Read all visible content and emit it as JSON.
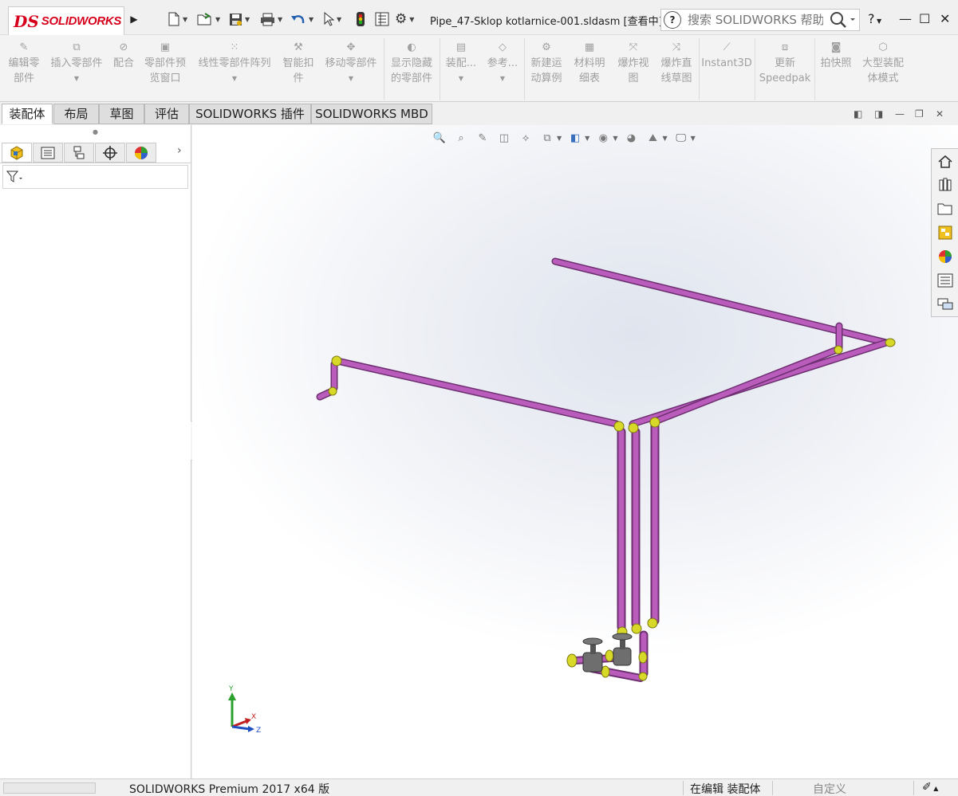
{
  "app": {
    "brand_ds": "DS",
    "brand_name": "SOLIDWORKS",
    "document_title": "Pipe_47-Sklop kotlarnice-001.sldasm [查看中]",
    "search_placeholder": "搜索 SOLIDWORKS 帮助",
    "help_label": "?"
  },
  "commands": [
    {
      "label": "编辑零\n部件",
      "icon": "edit-component-icon",
      "dropdown": false
    },
    {
      "label": "插入零部件",
      "icon": "insert-components-icon",
      "dropdown": true
    },
    {
      "label": "配合",
      "icon": "mate-icon",
      "dropdown": false
    },
    {
      "label": "零部件预\n览窗口",
      "icon": "component-preview-icon",
      "dropdown": false
    },
    {
      "label": "线性零部件阵列",
      "icon": "linear-pattern-icon",
      "dropdown": true
    },
    {
      "label": "智能扣\n件",
      "icon": "smart-fasteners-icon",
      "dropdown": false
    },
    {
      "label": "移动零部件",
      "icon": "move-component-icon",
      "dropdown": true
    },
    {
      "label": "显示隐藏\n的零部件",
      "icon": "show-hidden-icon",
      "dropdown": false
    },
    {
      "label": "装配...",
      "icon": "assembly-features-icon",
      "dropdown": true
    },
    {
      "label": "参考...",
      "icon": "reference-geometry-icon",
      "dropdown": true
    },
    {
      "label": "新建运\n动算例",
      "icon": "motion-study-icon",
      "dropdown": false
    },
    {
      "label": "材料明\n细表",
      "icon": "bom-icon",
      "dropdown": false
    },
    {
      "label": "爆炸视\n图",
      "icon": "exploded-view-icon",
      "dropdown": false
    },
    {
      "label": "爆炸直\n线草图",
      "icon": "explode-line-sketch-icon",
      "dropdown": false
    },
    {
      "label": "Instant3D",
      "icon": "instant3d-icon",
      "dropdown": false
    },
    {
      "label": "更新\nSpeedpak",
      "icon": "speedpak-icon",
      "dropdown": false
    },
    {
      "label": "拍快照",
      "icon": "snapshot-icon",
      "dropdown": false
    },
    {
      "label": "大型装配\n体模式",
      "icon": "large-assembly-icon",
      "dropdown": false
    }
  ],
  "tabs": [
    "装配体",
    "布局",
    "草图",
    "评估",
    "SOLIDWORKS 插件",
    "SOLIDWORKS MBD"
  ],
  "active_tab": "装配体",
  "triad": {
    "x": "X",
    "y": "Y",
    "z": "Z"
  },
  "status": {
    "product": "SOLIDWORKS Premium 2017 x64 版",
    "mode": "在编辑 装配体",
    "custom": "自定义"
  },
  "colors": {
    "pipe": "#b04fb3",
    "fitting": "#d8d828",
    "viewport_center": "#dfe4ee",
    "brand_red": "#d6001c"
  }
}
